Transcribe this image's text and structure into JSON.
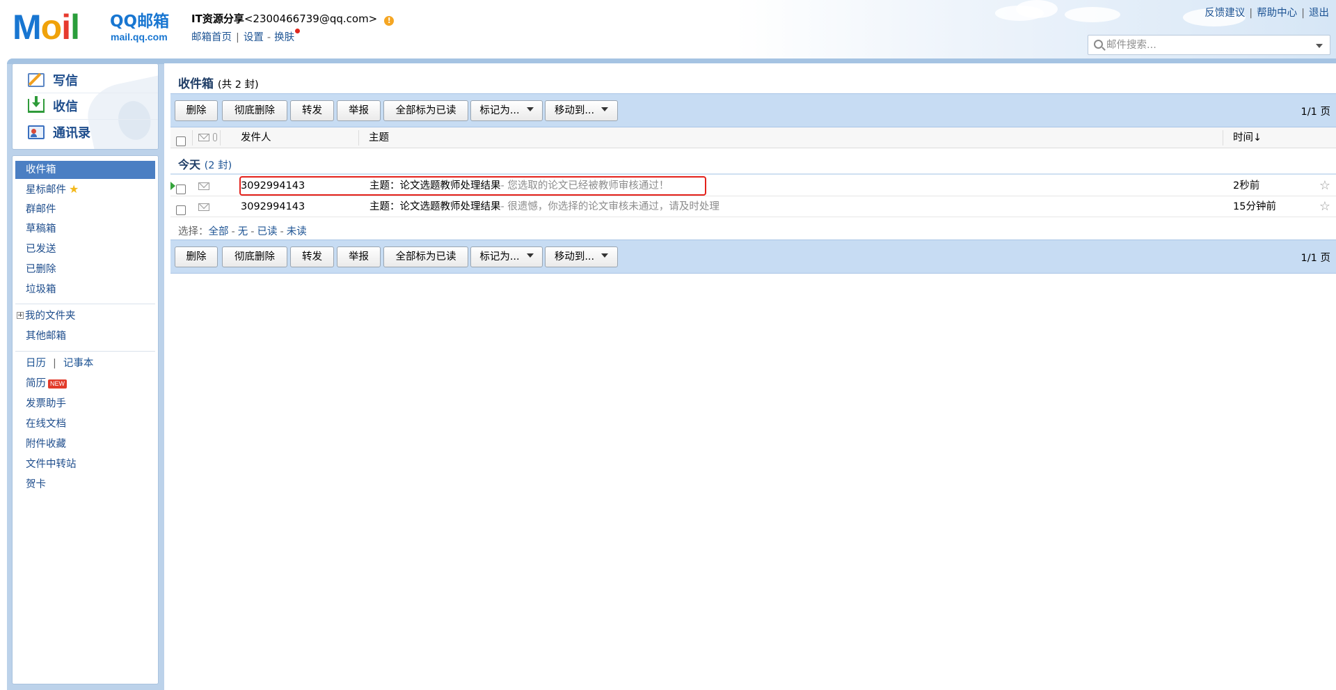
{
  "header": {
    "logo_word": [
      "M",
      "o",
      "i",
      "l"
    ],
    "logo_name": "QQ邮箱",
    "logo_url": "mail.qq.com",
    "account_nick": "IT资源分享",
    "account_email": "<2300466739@qq.com>",
    "links": {
      "home": "邮箱首页",
      "settings": "设置",
      "skin": "换肤"
    },
    "right_links": {
      "feedback": "反馈建议",
      "help": "帮助中心",
      "logout": "退出"
    },
    "search_placeholder": "邮件搜索..."
  },
  "sidebar": {
    "quick": {
      "compose": "写信",
      "receive": "收信",
      "contacts": "通讯录"
    },
    "folders": {
      "inbox": "收件箱",
      "starred": "星标邮件",
      "group": "群邮件",
      "drafts": "草稿箱",
      "sent": "已发送",
      "deleted": "已删除",
      "spam": "垃圾箱"
    },
    "my_folders": "我的文件夹",
    "other_mailbox": "其他邮箱",
    "tools": {
      "calendar": "日历",
      "notepad": "记事本",
      "resume": "简历",
      "new_badge": "NEW",
      "invoice": "发票助手",
      "docs": "在线文档",
      "attachments": "附件收藏",
      "transfer": "文件中转站",
      "cards": "贺卡"
    }
  },
  "main": {
    "title": "收件箱",
    "title_count": "(共 2 封)",
    "toolbar": {
      "delete": "删除",
      "delete_forever": "彻底删除",
      "forward": "转发",
      "report": "举报",
      "mark_all_read": "全部标为已读",
      "mark_as": "标记为...",
      "move_to": "移动到...",
      "pager": "1/1 页"
    },
    "columns": {
      "sender": "发件人",
      "subject": "主题",
      "time": "时间↓"
    },
    "group": {
      "label": "今天",
      "count": "(2 封)"
    },
    "emails": [
      {
        "sender": "3092994143",
        "subject": "主题：论文选题教师处理结果",
        "preview": "- 您选取的论文已经被教师审核通过！",
        "time": "2秒前",
        "selected": true
      },
      {
        "sender": "3092994143",
        "subject": "主题：论文选题教师处理结果",
        "preview": "- 很遗憾，你选择的论文审核未通过，请及时处理",
        "time": "15分钟前",
        "selected": false
      }
    ],
    "select": {
      "label": "选择：",
      "all": "全部",
      "none": "无",
      "read": "已读",
      "unread": "未读"
    }
  }
}
